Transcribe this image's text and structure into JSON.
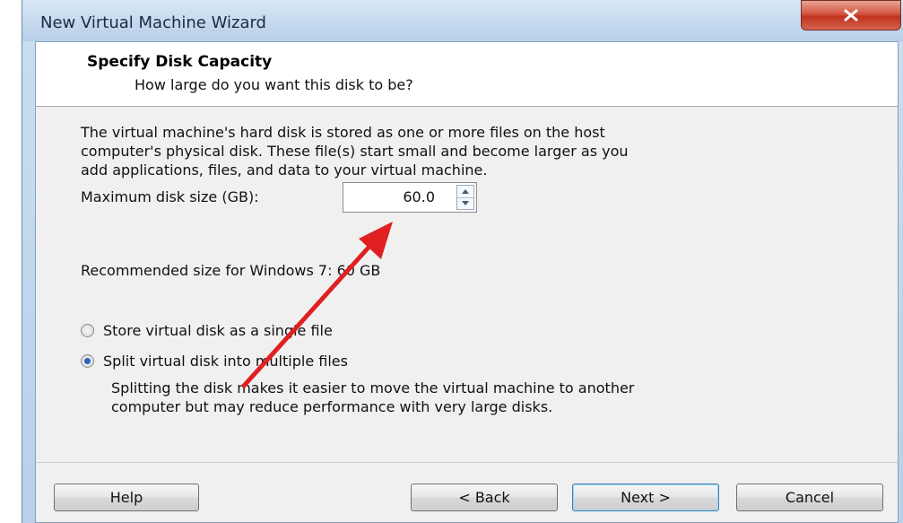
{
  "window": {
    "title": "New Virtual Machine Wizard",
    "close_label": "×"
  },
  "header": {
    "title": "Specify Disk Capacity",
    "subtitle": "How large do you want this disk to be?"
  },
  "body": {
    "description_lines": [
      "The virtual machine's hard disk is stored as one or more files on the host",
      "computer's physical disk. These file(s) start small and become larger as you",
      "add applications, files, and data to your virtual machine."
    ],
    "max_disk_size_label": "Maximum disk size (GB):",
    "max_disk_size_value": "60.0",
    "recommended_text": "Recommended size for Windows 7: 60 GB",
    "options": [
      {
        "label": "Store virtual disk as a single file",
        "selected": false
      },
      {
        "label": "Split virtual disk into multiple files",
        "selected": true
      }
    ],
    "split_description_lines": [
      "Splitting the disk makes it easier to move the virtual machine to another",
      "computer but may reduce performance with very large disks."
    ]
  },
  "buttons": {
    "help": "Help",
    "back": "< Back",
    "next": "Next >",
    "cancel": "Cancel"
  },
  "colors": {
    "annotation_arrow": "#e02020",
    "selected_radio": "#2b63b8"
  }
}
